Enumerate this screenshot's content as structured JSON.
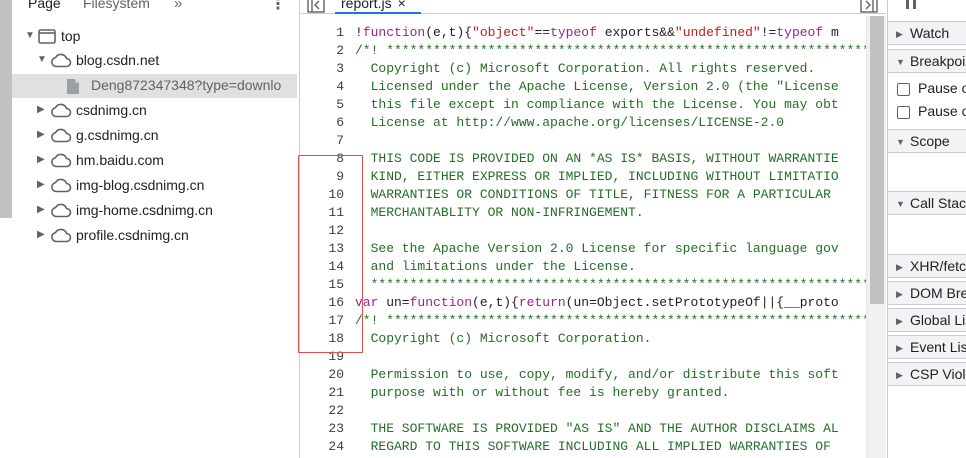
{
  "navigator": {
    "tabs": {
      "page": "Page",
      "filesystem": "Filesystem",
      "more": "»",
      "menu": "⋮"
    },
    "tree": [
      {
        "label": "top",
        "icon": "frame-icon",
        "expanded": true
      },
      {
        "label": "blog.csdn.net",
        "icon": "cloud-icon",
        "expanded": true
      },
      {
        "label": "Deng872347348?type=downlo",
        "icon": "file-icon",
        "selected": true
      },
      {
        "label": "csdnimg.cn",
        "icon": "cloud-icon",
        "expanded": false
      },
      {
        "label": "g.csdnimg.cn",
        "icon": "cloud-icon",
        "expanded": false
      },
      {
        "label": "hm.baidu.com",
        "icon": "cloud-icon",
        "expanded": false
      },
      {
        "label": "img-blog.csdnimg.cn",
        "icon": "cloud-icon",
        "expanded": false
      },
      {
        "label": "img-home.csdnimg.cn",
        "icon": "cloud-icon",
        "expanded": false
      },
      {
        "label": "profile.csdnimg.cn",
        "icon": "cloud-icon",
        "expanded": false
      }
    ]
  },
  "editor": {
    "file_tab": {
      "name": "report.js",
      "close": "×"
    },
    "line_numbers": [
      "1",
      "2",
      "3",
      "4",
      "5",
      "6",
      "7",
      "8",
      "9",
      "10",
      "11",
      "12",
      "13",
      "14",
      "15",
      "16",
      "17",
      "18",
      "19",
      "20",
      "21",
      "22",
      "23",
      "24"
    ],
    "lines": [
      "!function(e,t){\"object\"==typeof exports&&\"undefined\"!=typeof m",
      "/*! ****************************************************************************",
      "  Copyright (c) Microsoft Corporation. All rights reserved.",
      "  Licensed under the Apache License, Version 2.0 (the \"License",
      "  this file except in compliance with the License. You may obt",
      "  License at http://www.apache.org/licenses/LICENSE-2.0",
      "",
      "  THIS CODE IS PROVIDED ON AN *AS IS* BASIS, WITHOUT WARRANTIE",
      "  KIND, EITHER EXPRESS OR IMPLIED, INCLUDING WITHOUT LIMITATIO",
      "  WARRANTIES OR CONDITIONS OF TITLE, FITNESS FOR A PARTICULAR",
      "  MERCHANTABLITY OR NON-INFRINGEMENT.",
      "",
      "  See the Apache Version 2.0 License for specific language gov",
      "  and limitations under the License.",
      "  ****************************************************************************",
      "var un=function(e,t){return(un=Object.setPrototypeOf||{__proto",
      "/*! ****************************************************************************",
      "  Copyright (c) Microsoft Corporation.",
      "",
      "  Permission to use, copy, modify, and/or distribute this soft",
      "  purpose with or without fee is hereby granted.",
      "",
      "  THE SOFTWARE IS PROVIDED \"AS IS\" AND THE AUTHOR DISCLAIMS AL",
      "  REGARD TO THIS SOFTWARE INCLUDING ALL IMPLIED WARRANTIES OF"
    ],
    "colors": {
      "comment": "#236e25",
      "keyword": "#9b2393",
      "string": "#c41a16",
      "annotation_box": "#e05050"
    }
  },
  "debugger": {
    "sections": [
      {
        "title": "Watch",
        "expanded": false
      },
      {
        "title": "Breakpoints",
        "expanded": true
      },
      {
        "title": "Scope",
        "expanded": true
      },
      {
        "title": "Call Stack",
        "expanded": true
      },
      {
        "title": "XHR/fetch Breakpoints",
        "expanded": false
      },
      {
        "title": "DOM Breakpoints",
        "expanded": false
      },
      {
        "title": "Global Listeners",
        "expanded": false
      },
      {
        "title": "Event Listener Breakpoints",
        "expanded": false
      },
      {
        "title": "CSP Violation Breakpoints",
        "expanded": false
      }
    ],
    "checkboxes": [
      {
        "label": "Pause on uncaught exceptions",
        "checked": false
      },
      {
        "label": "Pause on caught exceptions",
        "checked": false
      }
    ]
  }
}
